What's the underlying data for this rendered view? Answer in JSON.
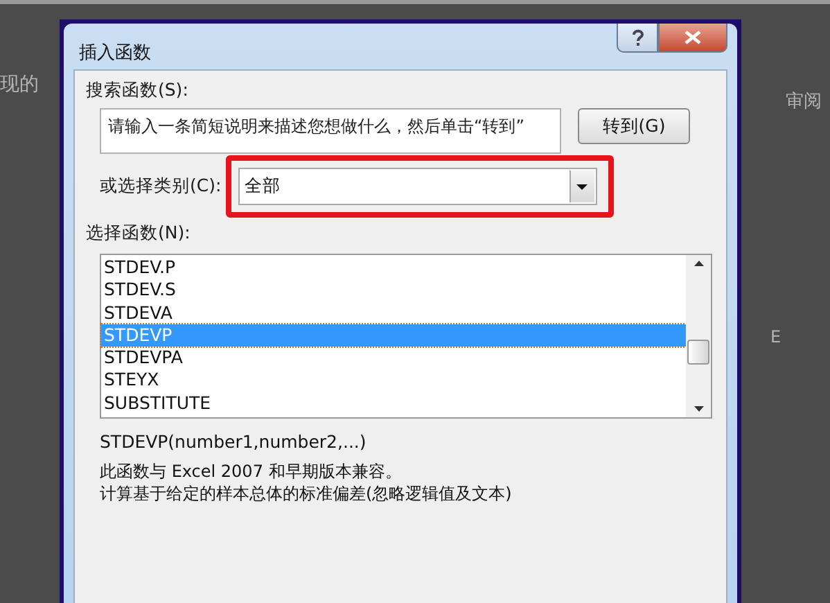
{
  "background": {
    "texts": [
      {
        "kind": "left",
        "text": "现的"
      },
      {
        "kind": "tab",
        "text": "审阅"
      },
      {
        "kind": "column",
        "text": "E"
      }
    ]
  },
  "dialog": {
    "title": "插入函数",
    "search": {
      "label": "搜索函数(S):",
      "value": "请输入一条简短说明来描述您想做什么，然后单击“转到”",
      "button": "转到(G)"
    },
    "category": {
      "label": "或选择类别(C):",
      "value": "全部"
    },
    "functions": {
      "label": "选择函数(N):",
      "items": [
        {
          "name": "STDEV.P",
          "selected": false
        },
        {
          "name": "STDEV.S",
          "selected": false
        },
        {
          "name": "STDEVA",
          "selected": false
        },
        {
          "name": "STDEVP",
          "selected": true
        },
        {
          "name": "STDEVPA",
          "selected": false
        },
        {
          "name": "STEYX",
          "selected": false
        },
        {
          "name": "SUBSTITUTE",
          "selected": false
        }
      ]
    },
    "syntax": "STDEVP(number1,number2,...)",
    "description": [
      "此函数与 Excel 2007 和早期版本兼容。",
      "计算基于给定的样本总体的标准偏差(忽略逻辑值及文本)"
    ]
  }
}
